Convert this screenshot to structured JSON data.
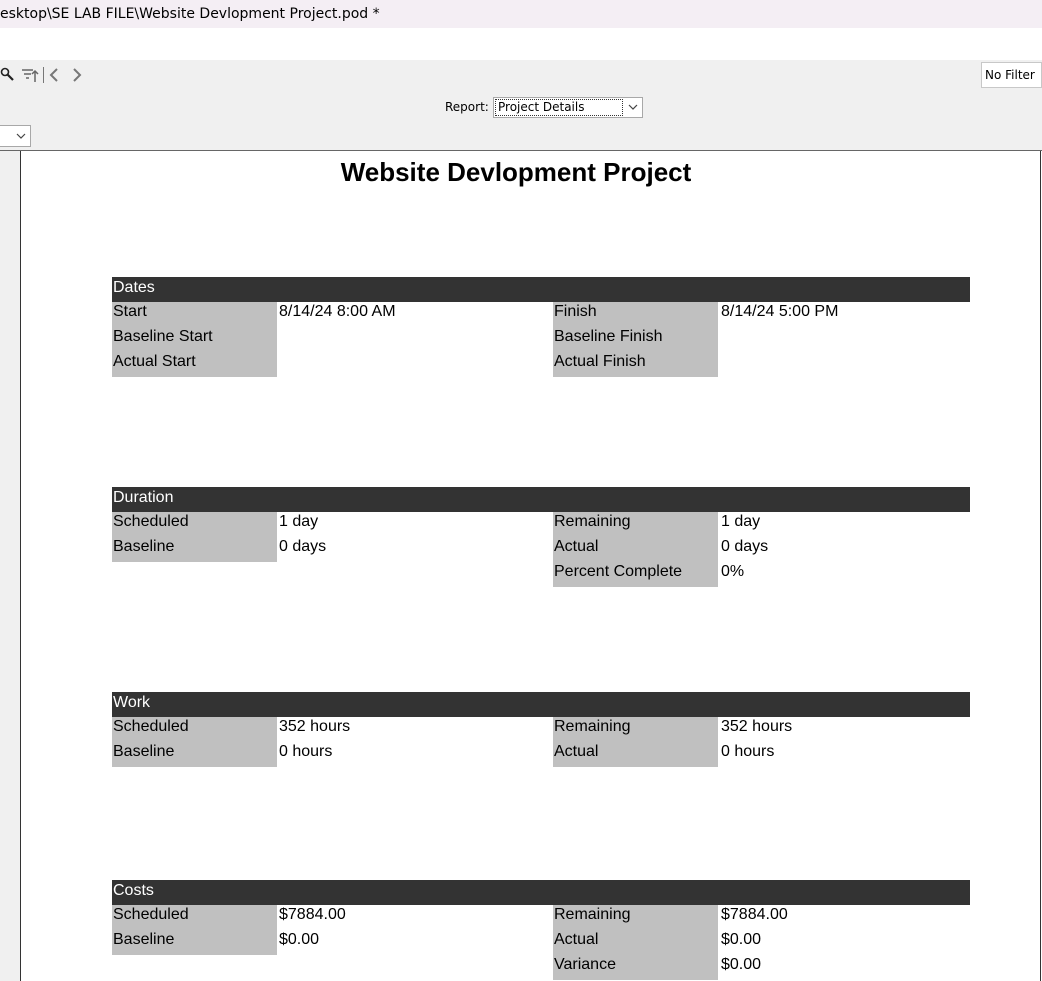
{
  "window": {
    "title": "esktop\\SE LAB FILE\\Website Devlopment Project.pod *"
  },
  "toolbar": {
    "icons": [
      "zoom-icon",
      "filter-icon",
      "back-arrow-icon",
      "forward-arrow-icon"
    ],
    "filter_value": "No Filter",
    "report_label": "Report:",
    "report_value": "Project Details"
  },
  "document": {
    "title": "Website Devlopment Project",
    "sections": {
      "dates": {
        "header": "Dates",
        "left": [
          {
            "label": "Start",
            "value": "8/14/24 8:00 AM"
          },
          {
            "label": "Baseline Start",
            "value": ""
          },
          {
            "label": "Actual Start",
            "value": ""
          }
        ],
        "right": [
          {
            "label": "Finish",
            "value": "8/14/24 5:00 PM"
          },
          {
            "label": "Baseline Finish",
            "value": ""
          },
          {
            "label": "Actual Finish",
            "value": ""
          }
        ]
      },
      "duration": {
        "header": "Duration",
        "left": [
          {
            "label": "Scheduled",
            "value": "1 day"
          },
          {
            "label": "Baseline",
            "value": "0 days"
          }
        ],
        "right": [
          {
            "label": "Remaining",
            "value": "1 day"
          },
          {
            "label": "Actual",
            "value": "0 days"
          },
          {
            "label": "Percent Complete",
            "value": "0%"
          }
        ]
      },
      "work": {
        "header": "Work",
        "left": [
          {
            "label": "Scheduled",
            "value": "352 hours"
          },
          {
            "label": "Baseline",
            "value": "0 hours"
          }
        ],
        "right": [
          {
            "label": "Remaining",
            "value": "352 hours"
          },
          {
            "label": "Actual",
            "value": "0 hours"
          }
        ]
      },
      "costs": {
        "header": "Costs",
        "left": [
          {
            "label": "Scheduled",
            "value": "$7884.00"
          },
          {
            "label": "Baseline",
            "value": "$0.00"
          }
        ],
        "right": [
          {
            "label": "Remaining",
            "value": "$7884.00"
          },
          {
            "label": "Actual",
            "value": "$0.00"
          },
          {
            "label": "Variance",
            "value": "$0.00"
          }
        ]
      }
    }
  }
}
